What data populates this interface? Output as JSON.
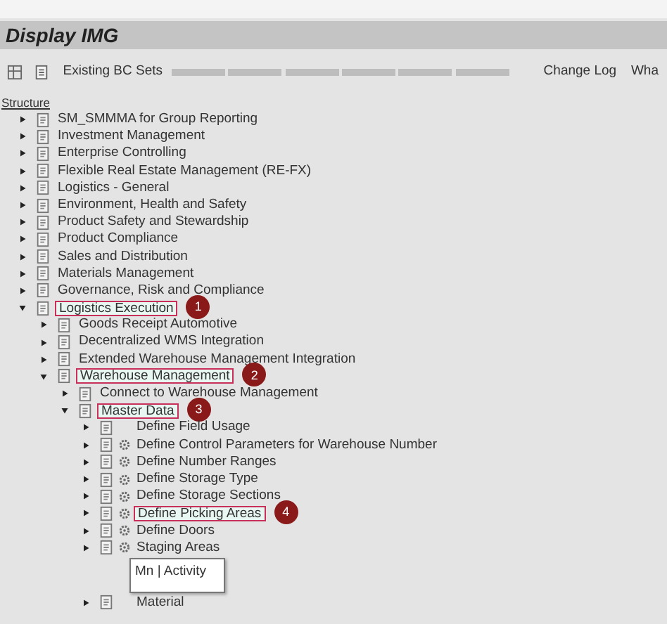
{
  "window": {
    "title": "Display IMG"
  },
  "toolbar": {
    "buttons": [
      "Existing BC Sets",
      "Change Log",
      "Wha"
    ]
  },
  "structure_label": "Structure",
  "tree": [
    {
      "label": "SM_SMMMA for Group Reporting",
      "expanded": false
    },
    {
      "label": "Investment Management",
      "expanded": false
    },
    {
      "label": "Enterprise Controlling",
      "expanded": false
    },
    {
      "label": "Flexible Real Estate Management (RE-FX)",
      "expanded": false
    },
    {
      "label": "Logistics - General",
      "expanded": false
    },
    {
      "label": "Environment, Health and Safety",
      "expanded": false
    },
    {
      "label": "Product Safety and Stewardship",
      "expanded": false
    },
    {
      "label": "Product Compliance",
      "expanded": false
    },
    {
      "label": "Sales and Distribution",
      "expanded": false
    },
    {
      "label": "Materials Management",
      "expanded": false
    },
    {
      "label": "Governance, Risk and Compliance",
      "expanded": false
    },
    {
      "label": "Logistics Execution",
      "expanded": true,
      "callout": "1",
      "children": [
        {
          "label": "Goods Receipt Automotive",
          "expanded": false
        },
        {
          "label": "Decentralized WMS Integration",
          "expanded": false
        },
        {
          "label": "Extended Warehouse Management Integration",
          "expanded": false
        },
        {
          "label": "Warehouse Management",
          "expanded": true,
          "callout": "2",
          "children": [
            {
              "label": "Connect to Warehouse Management",
              "expanded": false
            },
            {
              "label": "Master Data",
              "expanded": true,
              "callout": "3",
              "children": [
                {
                  "label": "Define Field Usage",
                  "expanded": false,
                  "kind": "folder"
                },
                {
                  "label": "Define Control Parameters for Warehouse Number",
                  "expanded": false,
                  "kind": "activity"
                },
                {
                  "label": "Define Number Ranges",
                  "expanded": false,
                  "kind": "activity"
                },
                {
                  "label": "Define Storage Type",
                  "expanded": false,
                  "kind": "activity"
                },
                {
                  "label": "Define Storage Sections",
                  "expanded": false,
                  "kind": "activity"
                },
                {
                  "label": "Define Picking Areas",
                  "expanded": false,
                  "kind": "activity",
                  "callout": "4"
                },
                {
                  "label": "Define Doors",
                  "expanded": false,
                  "kind": "activity"
                },
                {
                  "label": "Staging Areas",
                  "expanded": false,
                  "kind": "activity"
                },
                {
                  "label": "Material",
                  "expanded": false,
                  "kind": "folder"
                }
              ]
            }
          ]
        }
      ]
    }
  ],
  "popup": {
    "text": "Mn | Activity"
  }
}
